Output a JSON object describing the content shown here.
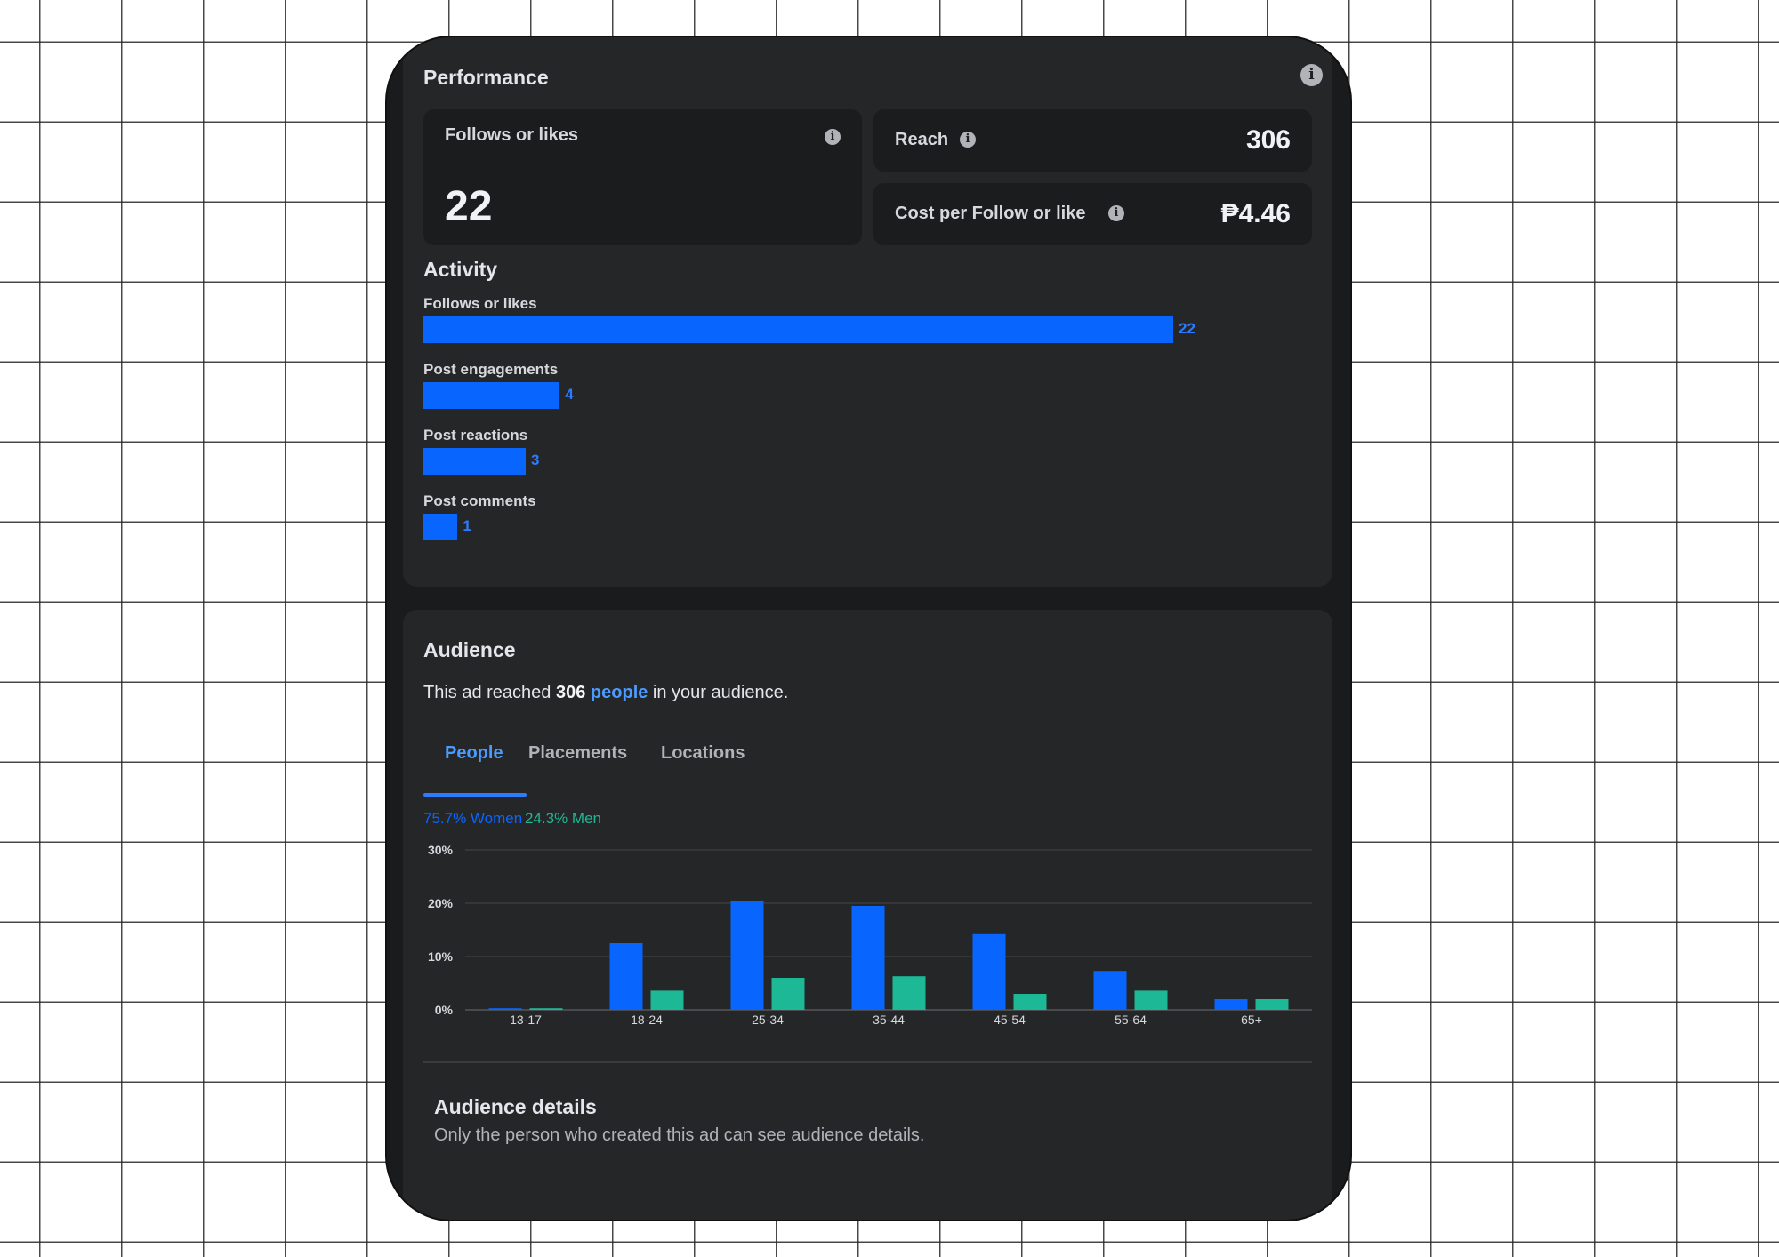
{
  "performance": {
    "title": "Performance",
    "follows": {
      "label": "Follows or likes",
      "value": "22"
    },
    "reach": {
      "label": "Reach",
      "value": "306"
    },
    "cost": {
      "label": "Cost per Follow or like",
      "value": "₱4.46"
    }
  },
  "activity": {
    "title": "Activity",
    "items": [
      {
        "label": "Follows or likes",
        "value": 22,
        "display": "22"
      },
      {
        "label": "Post engagements",
        "value": 4,
        "display": "4"
      },
      {
        "label": "Post reactions",
        "value": 3,
        "display": "3"
      },
      {
        "label": "Post comments",
        "value": 1,
        "display": "1"
      }
    ]
  },
  "audience": {
    "title": "Audience",
    "reach_prefix": "This ad reached ",
    "reach_count": "306",
    "reach_link": "people",
    "reach_suffix": " in your audience.",
    "tabs": [
      {
        "label": "People"
      },
      {
        "label": "Placements"
      },
      {
        "label": "Locations"
      }
    ],
    "legend_women": "75.7% Women",
    "legend_men": "24.3% Men",
    "details_title": "Audience details",
    "details_text": "Only the person who created this ad can see audience details."
  },
  "colors": {
    "accent": "#0866ff",
    "women": "#0866ff",
    "men": "#1db895",
    "link": "#4b9bff"
  },
  "chart_data": {
    "type": "bar",
    "categories": [
      "13-17",
      "18-24",
      "25-34",
      "35-44",
      "45-54",
      "55-64",
      "65+"
    ],
    "series": [
      {
        "name": "Women",
        "values": [
          0.3,
          12.5,
          20.5,
          19.5,
          14.2,
          7.3,
          2.0
        ]
      },
      {
        "name": "Men",
        "values": [
          0.3,
          3.6,
          6.0,
          6.3,
          3.0,
          3.6,
          2.0
        ]
      }
    ],
    "ylim": [
      0,
      30
    ],
    "yticks": [
      0,
      10,
      20,
      30
    ],
    "ytick_labels": [
      "0%",
      "10%",
      "20%",
      "30%"
    ],
    "grid": true
  }
}
